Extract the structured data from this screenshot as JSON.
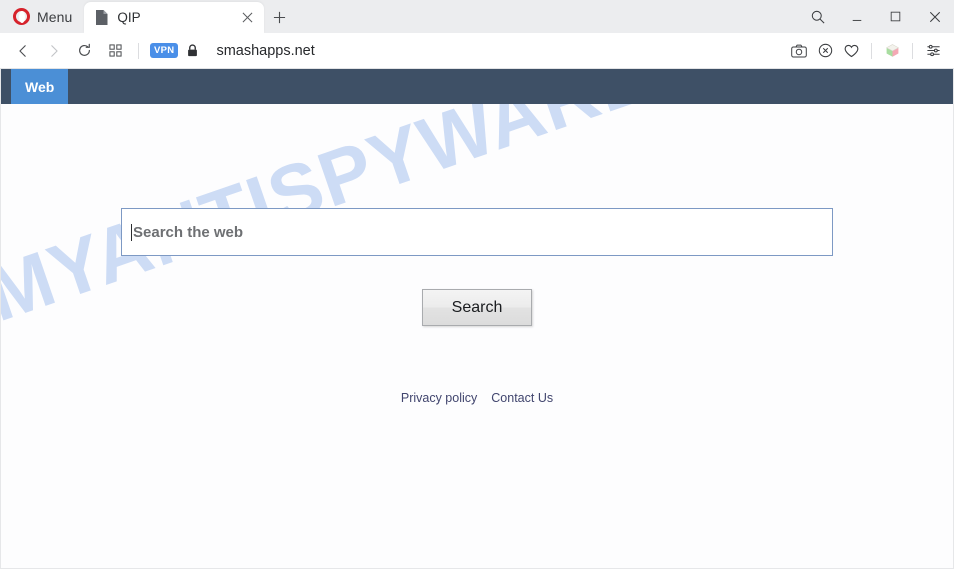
{
  "browser": {
    "menu_label": "Menu",
    "tab": {
      "title": "QIP",
      "favicon": "page-icon",
      "close": "×"
    },
    "new_tab": "+",
    "window_controls": {
      "search": "search-icon",
      "minimize": "minimize-icon",
      "maximize": "maximize-icon",
      "close": "close-icon"
    },
    "nav": {
      "back": "back-arrow-icon",
      "forward": "forward-arrow-icon",
      "reload": "reload-icon",
      "workspaces": "grid-icon"
    },
    "address": {
      "vpn_badge": "VPN",
      "lock": "padlock-icon",
      "url": "smashapps.net"
    },
    "toolbar_right": {
      "snapshot": "camera-icon",
      "adblock": "shield-block-icon",
      "favorites": "heart-icon",
      "extension": "cube-icon",
      "easy_setup": "sliders-icon"
    }
  },
  "page": {
    "navbar": {
      "tabs": [
        {
          "label": "Web",
          "active": true
        }
      ]
    },
    "search": {
      "placeholder": "Search the web",
      "value": "",
      "button_label": "Search"
    },
    "footer": {
      "links": [
        {
          "label": "Privacy policy"
        },
        {
          "label": "Contact Us"
        }
      ]
    },
    "watermark": "MYANTISPYWARE.COM"
  },
  "colors": {
    "navbar_bg": "#3e5066",
    "navbar_tab_bg": "#4b8fd6",
    "vpn_badge": "#4a8fe8",
    "opera_red": "#d6222b",
    "search_border": "#7d99c4",
    "watermark": "#cddcf5"
  }
}
